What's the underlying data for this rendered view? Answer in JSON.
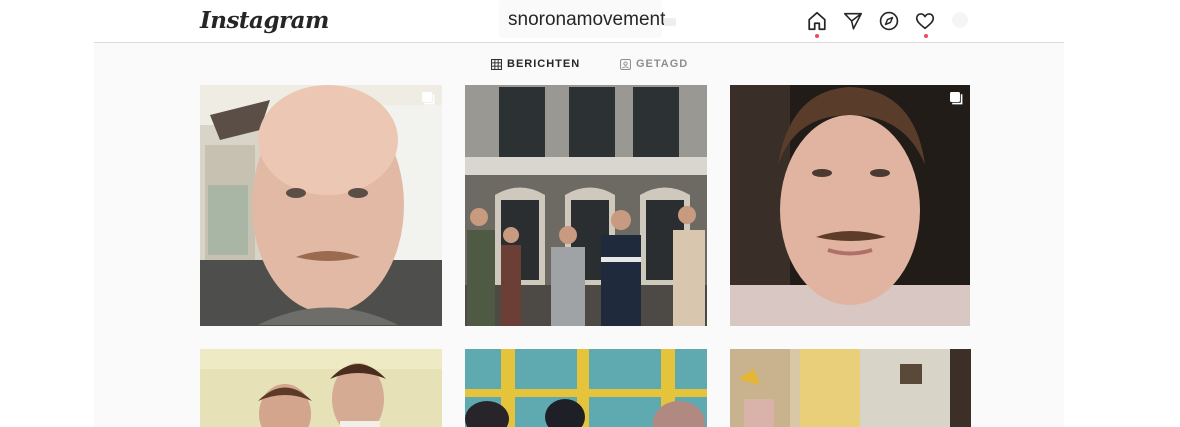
{
  "header": {
    "logo_text": "Instagram",
    "search_value": "snoronamovement",
    "nav_icons": [
      "home-icon",
      "direct-message-icon",
      "explore-icon",
      "activity-heart-icon"
    ],
    "notification_color": "#ed4956"
  },
  "profile_tabs": [
    {
      "label": "BERICHTEN",
      "icon": "grid-icon",
      "active": true
    },
    {
      "label": "GETAGD",
      "icon": "tagged-icon",
      "active": false
    }
  ],
  "posts": [
    {
      "description": "bald man with moustache in office",
      "multiple": true
    },
    {
      "description": "group of men in front of building",
      "multiple": false
    },
    {
      "description": "young man with moustache close-up",
      "multiple": true
    },
    {
      "description": "two men posing",
      "multiple": false
    },
    {
      "description": "group in front of blue and yellow window",
      "multiple": false
    },
    {
      "description": "room with lamp and curtains",
      "multiple": false
    }
  ],
  "colors": {
    "border": "#dbdbdb",
    "text_primary": "#262626",
    "text_secondary": "#8e8e8e",
    "background": "#fafafa"
  }
}
